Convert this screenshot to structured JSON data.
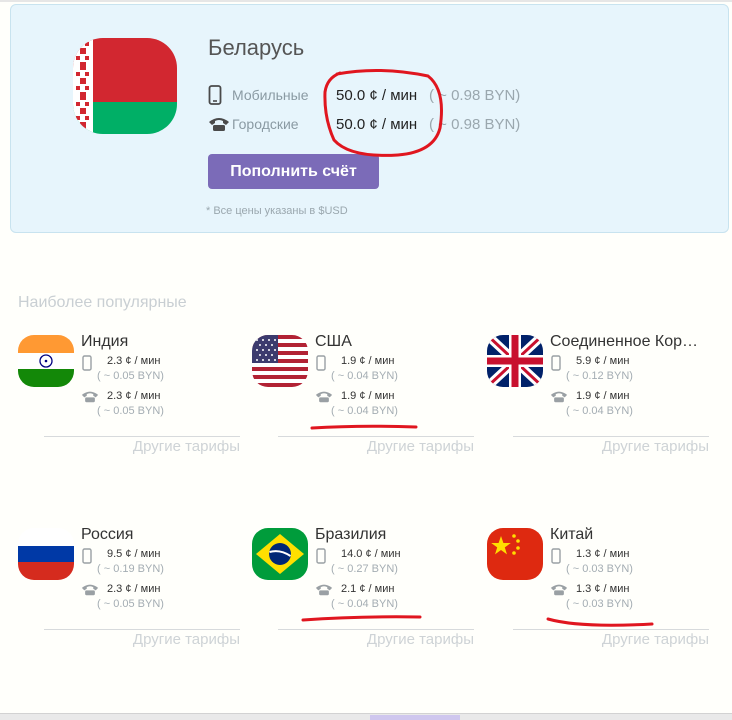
{
  "main": {
    "country": "Беларусь",
    "mobile_label": "Мобильные",
    "mobile_value": "50.0 ¢ / мин",
    "mobile_byn": "( ~ 0.98 BYN)",
    "landline_label": "Городские",
    "landline_value": "50.0 ¢ / мин",
    "landline_byn": "( ~ 0.98 BYN)",
    "topup_label": "Пополнить счёт",
    "note": "* Все цены указаны в $USD"
  },
  "popular": {
    "title": "Наиболее популярные",
    "more_label": "Другие тарифы",
    "countries": [
      {
        "name": "Индия",
        "flag": "india-flag-icon",
        "mobile": "2.3 ¢ / мин",
        "mobile_byn": "( ~ 0.05 BYN)",
        "landline": "2.3 ¢ / мин",
        "landline_byn": "( ~ 0.05 BYN)"
      },
      {
        "name": "США",
        "flag": "usa-flag-icon",
        "mobile": "1.9 ¢ / мин",
        "mobile_byn": "( ~ 0.04 BYN)",
        "landline": "1.9 ¢ / мин",
        "landline_byn": "( ~ 0.04 BYN)"
      },
      {
        "name": "Соединенное Кор…",
        "flag": "uk-flag-icon",
        "mobile": "5.9 ¢ / мин",
        "mobile_byn": "( ~ 0.12 BYN)",
        "landline": "1.9 ¢ / мин",
        "landline_byn": "( ~ 0.04 BYN)"
      },
      {
        "name": "Россия",
        "flag": "russia-flag-icon",
        "mobile": "9.5 ¢ / мин",
        "mobile_byn": "( ~ 0.19 BYN)",
        "landline": "2.3 ¢ / мин",
        "landline_byn": "( ~ 0.05 BYN)"
      },
      {
        "name": "Бразилия",
        "flag": "brazil-flag-icon",
        "mobile": "14.0 ¢ / мин",
        "mobile_byn": "( ~ 0.27 BYN)",
        "landline": "2.1 ¢ / мин",
        "landline_byn": "( ~ 0.04 BYN)"
      },
      {
        "name": "Китай",
        "flag": "china-flag-icon",
        "mobile": "1.3 ¢ / мин",
        "mobile_byn": "( ~ 0.03 BYN)",
        "landline": "1.3 ¢ / мин",
        "landline_byn": "( ~ 0.03 BYN)"
      }
    ]
  },
  "icons": {
    "mobile": "mobile-phone-icon",
    "landline": "landline-phone-icon"
  },
  "colors": {
    "card_bg": "#e7f5fc",
    "button": "#7b6bb8",
    "annotation": "#e0161f"
  }
}
